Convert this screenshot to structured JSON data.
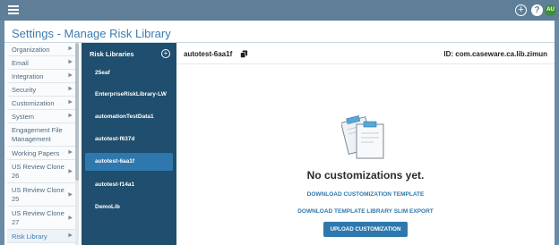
{
  "topbar": {
    "icons": {
      "menu": "hamburger-icon",
      "add": "plus-circle-icon",
      "help": "question-icon"
    },
    "avatar_initials": "AU",
    "colors": {
      "bar": "#5f7f99",
      "avatar": "#3f8f3a"
    }
  },
  "page": {
    "title": "Settings - Manage Risk Library"
  },
  "sidebar": {
    "items": [
      {
        "label": "Organization"
      },
      {
        "label": "Email"
      },
      {
        "label": "Integration"
      },
      {
        "label": "Security"
      },
      {
        "label": "Customization"
      },
      {
        "label": "System"
      },
      {
        "label": "Engagement File Management"
      },
      {
        "label": "Working Papers"
      },
      {
        "label": "US Review Clone 26"
      },
      {
        "label": "US Review Clone 25"
      },
      {
        "label": "US Review Clone 27"
      },
      {
        "label": "Risk Library"
      }
    ],
    "active": "Risk Library"
  },
  "libraries": {
    "header": "Risk Libraries",
    "items": [
      {
        "label": "25eaf"
      },
      {
        "label": "EnterpriseRiskLibrary-LW"
      },
      {
        "label": "automationTestData1"
      },
      {
        "label": "autotest-f637d"
      },
      {
        "label": "autotest-6aa1f"
      },
      {
        "label": "autotest-f14a1"
      },
      {
        "label": "DemoLib"
      }
    ],
    "selected": "autotest-6aa1f",
    "colors": {
      "panel": "#1f4e6e",
      "selected": "#2e78ad"
    }
  },
  "detail": {
    "name": "autotest-6aa1f",
    "id_label": "ID: com.caseware.ca.lib.zimun",
    "empty_title": "No customizations yet.",
    "download_template": "DOWNLOAD CUSTOMIZATION TEMPLATE",
    "download_export": "DOWNLOAD TEMPLATE LIBRARY SLIM EXPORT",
    "upload": "UPLOAD CUSTOMIZATION",
    "illustration": "clipboard-documents-icon",
    "accent": "#2e78ad"
  }
}
